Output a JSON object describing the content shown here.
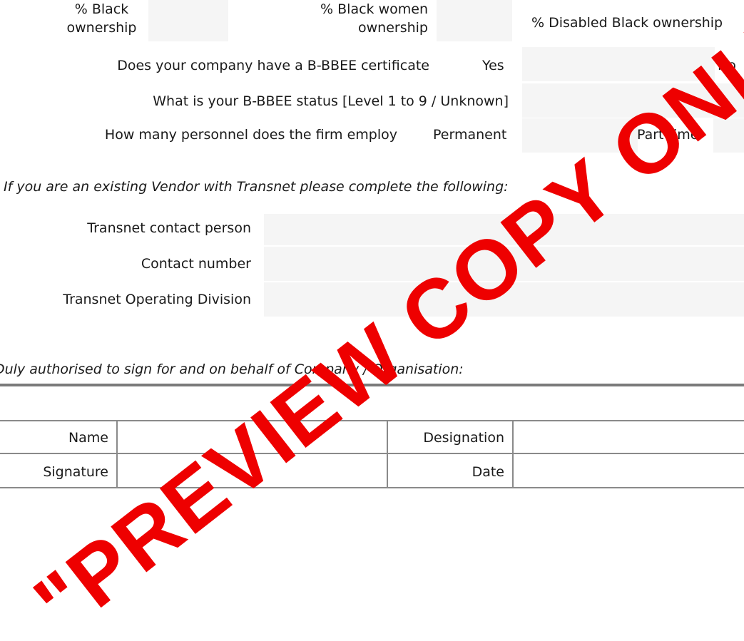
{
  "ownership": {
    "black_label": "% Black ownership",
    "black_women_label": "% Black women ownership",
    "disabled_black_label": "% Disabled Black ownership"
  },
  "bbbee": {
    "certificate_question": "Does your company have a B-BBEE certificate",
    "yes_label": "Yes",
    "no_label": "No",
    "status_question": "What is your B-BBEE status [Level 1 to 9 / Unknown]"
  },
  "personnel": {
    "question": "How many personnel does the firm employ",
    "permanent_label": "Permanent",
    "part_time_label": "Part time"
  },
  "vendor": {
    "heading": "If you are an existing Vendor with Transnet please complete the following:",
    "contact_person_label": "Transnet contact person",
    "contact_number_label": "Contact number",
    "operating_division_label": "Transnet Operating Division"
  },
  "signoff": {
    "heading": "Duly authorised to sign for and on behalf of Company / Organisation:",
    "name_label": "Name",
    "designation_label": "Designation",
    "signature_label": "Signature",
    "date_label": "Date"
  },
  "watermark": {
    "text": "\"PREVIEW COPY ONLY\""
  },
  "colors": {
    "watermark": "#ee0000",
    "field_fill": "#f5f5f5",
    "rule": "#7a7a7a"
  }
}
